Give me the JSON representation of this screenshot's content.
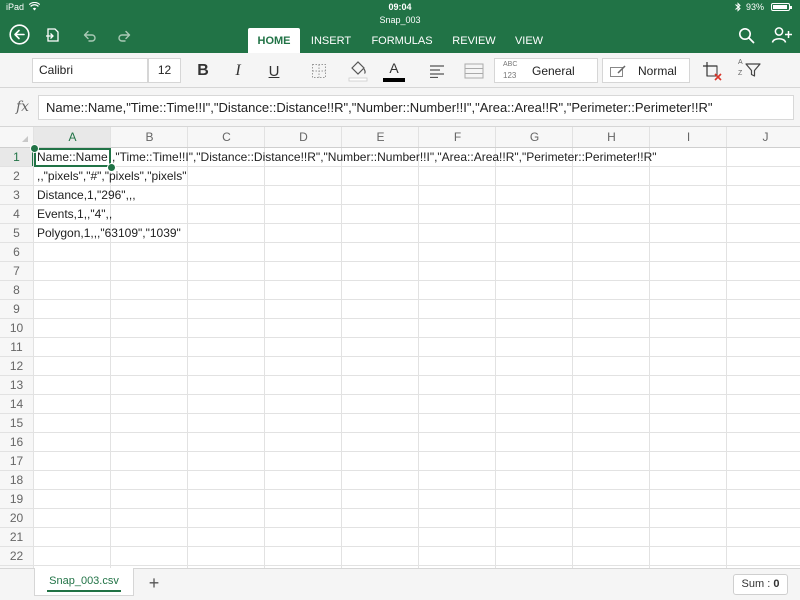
{
  "status_bar": {
    "carrier": "iPad",
    "time": "09:04",
    "battery": "93%",
    "battery_level": 0.93
  },
  "document": {
    "title": "Snap_003"
  },
  "ribbon": {
    "tabs": [
      {
        "label": "HOME",
        "active": true
      },
      {
        "label": "INSERT",
        "active": false
      },
      {
        "label": "FORMULAS",
        "active": false
      },
      {
        "label": "REVIEW",
        "active": false
      },
      {
        "label": "VIEW",
        "active": false
      }
    ]
  },
  "toolbar": {
    "font_name": "Calibri",
    "font_size": "12",
    "bold": "B",
    "italic": "I",
    "underline": "U",
    "font_color_glyph": "A",
    "font_color": "#000000",
    "number_format_badge_top": "ABC",
    "number_format_badge_bottom": "123",
    "number_format": "General",
    "cell_style": "Normal",
    "sort_badge_top": "A",
    "sort_badge_bottom": "Z"
  },
  "formula_bar": {
    "fx": "fx",
    "content": "Name::Name,\"Time::Time!!I\",\"Distance::Distance!!R\",\"Number::Number!!I\",\"Area::Area!!R\",\"Perimeter::Perimeter!!R\""
  },
  "grid": {
    "columns": [
      "A",
      "B",
      "C",
      "D",
      "E",
      "F",
      "G",
      "H",
      "I",
      "J"
    ],
    "rows": [
      "1",
      "2",
      "3",
      "4",
      "5",
      "6",
      "7",
      "8",
      "9",
      "10",
      "11",
      "12",
      "13",
      "14",
      "15",
      "16",
      "17",
      "18",
      "19",
      "20",
      "21",
      "22"
    ],
    "partial_row": "23",
    "selected_cell": "A1",
    "cells": {
      "A1_visible": "Name::Name",
      "A1_overflow": ",\"Time::Time!!I\",\"Distance::Distance!!R\",\"Number::Number!!I\",\"Area::Area!!R\",\"Perimeter::Perimeter!!R\"",
      "A2": ",,\"pixels\",\"#\",\"pixels\",\"pixels\"",
      "A3": "Distance,1,\"296\",,,",
      "A4": "Events,1,,\"4\",,",
      "A5": "Polygon,1,,,\"63109\",\"1039\""
    }
  },
  "sheets": {
    "tabs": [
      "Snap_003.csv"
    ],
    "add_label": "+",
    "sum_label": "Sum :",
    "sum_value": "0"
  },
  "colors": {
    "accent": "#217346",
    "toolbar_bg": "#f5f5f5",
    "gridline": "#e2e2e2"
  },
  "icons": {
    "back": "back-circle-icon",
    "share": "share-doc-icon",
    "undo": "undo-icon",
    "redo": "redo-icon",
    "search": "search-icon",
    "add_person": "add-person-icon",
    "borders": "borders-icon",
    "fill": "fill-color-icon",
    "align": "align-icon",
    "wrap": "wrap-merge-icon",
    "format": "format-cells-icon",
    "insert_delete": "insert-delete-cells-icon",
    "sort_filter": "sort-filter-icon"
  }
}
